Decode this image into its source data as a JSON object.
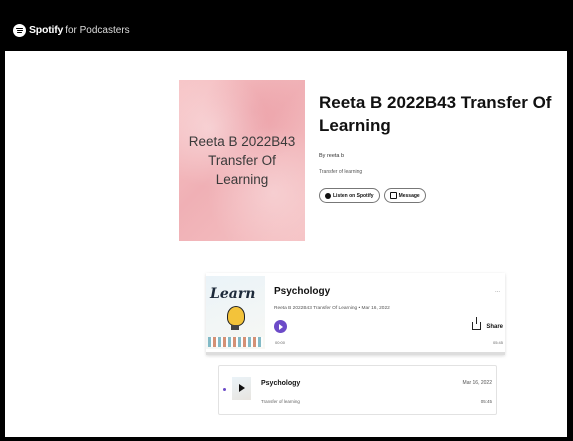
{
  "header": {
    "brand_name": "Spotify",
    "brand_sub": "for Podcasters"
  },
  "show": {
    "cover_text": "Reeta B 2022B43 Transfer Of Learning",
    "title": "Reeta B 2022B43 Transfer Of Learning",
    "author": "By reeta b",
    "description": "Transfer of learning",
    "listen_label": "Listen on Spotify",
    "message_label": "Message"
  },
  "featured_episode": {
    "thumbnail_word": "Learn",
    "title": "Psychology",
    "subtitle": "Reeta B 2022B43 Transfer Of Learning • Mar 16, 2022",
    "time_elapsed": "00:00",
    "time_total": "05:45",
    "share_label": "Share",
    "more": "...",
    "progress": 0
  },
  "episodes": [
    {
      "title": "Psychology",
      "description": "Transfer of learning",
      "date": "Mar 16, 2022",
      "duration": "05:45"
    }
  ],
  "colors": {
    "accent": "#6c4bc8",
    "cover_bg": "#f4c0c3",
    "topbar": "#000000"
  }
}
